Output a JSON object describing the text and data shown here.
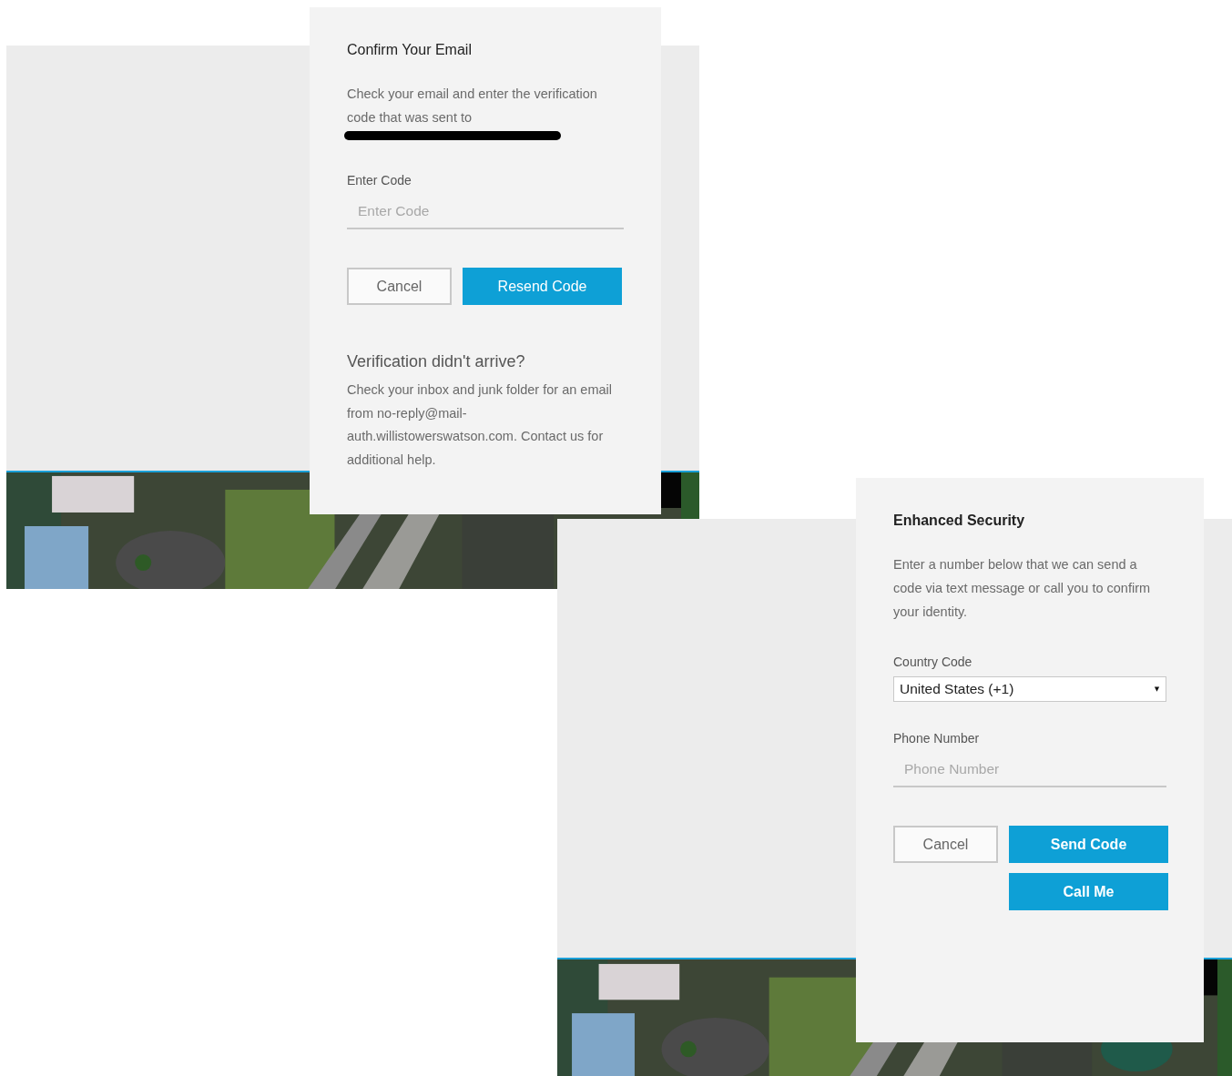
{
  "screens": [
    {
      "kind": "confirm_email",
      "title": "Confirm Your Email",
      "message": "Check your email and enter the verification code that was sent to",
      "email_redacted": true,
      "fields": [
        {
          "kind": "text",
          "label": "Enter Code",
          "placeholder": "Enter Code"
        }
      ],
      "buttons": [
        {
          "kind": "secondary",
          "label": "Cancel"
        },
        {
          "kind": "primary",
          "label": "Resend Code"
        }
      ],
      "help": {
        "heading": "Verification didn't arrive?",
        "text": "Check your inbox and junk folder for an email from no-reply@mail-auth.willistowerswatson.com. Contact us for additional help."
      }
    },
    {
      "kind": "enhanced_security",
      "title": "Enhanced Security",
      "message": "Enter a number below that we can send a code via text message or call you to confirm your identity.",
      "email_redacted": false,
      "fields": [
        {
          "kind": "select",
          "label": "Country Code",
          "value": "United States (+1)"
        },
        {
          "kind": "text",
          "label": "Phone Number",
          "placeholder": "Phone Number"
        }
      ],
      "buttons": [
        {
          "kind": "secondary",
          "label": "Cancel"
        },
        {
          "kind": "primary",
          "label": "Send Code"
        },
        {
          "kind": "primary",
          "label": "Call Me"
        }
      ]
    }
  ]
}
